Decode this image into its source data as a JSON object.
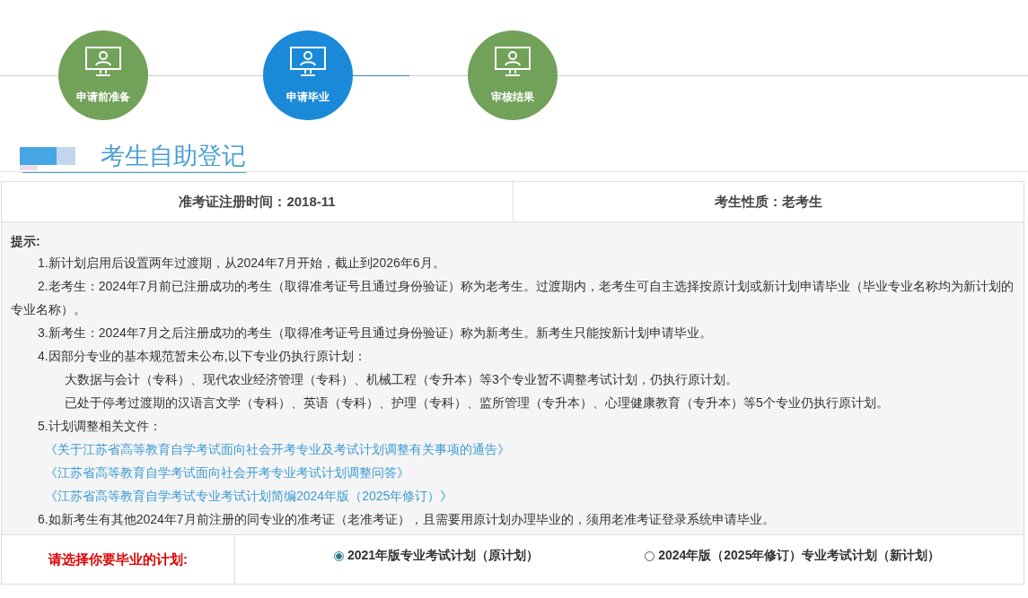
{
  "steps": [
    {
      "label": "申请前准备",
      "selected": false
    },
    {
      "label": "申请毕业",
      "selected": true
    },
    {
      "label": "审核结果",
      "selected": false
    }
  ],
  "section_title": "考生自助登记",
  "info": [
    {
      "label": "准考证注册时间：",
      "value": "2018-11"
    },
    {
      "label": "考生性质：",
      "value": "老考生"
    }
  ],
  "notes": {
    "heading": "提示:",
    "items": [
      {
        "text": "1.新计划启用后设置两年过渡期，从2024年7月开始，截止到2026年6月。"
      },
      {
        "text": "2.老考生：2024年7月前已注册成功的考生（取得准考证号且通过身份验证）称为老考生。过渡期内，老考生可自主选择按原计划或新计划申请毕业（毕业专业名称均为新计划的专业名称）。"
      },
      {
        "text": "3.新考生：2024年7月之后注册成功的考生（取得准考证号且通过身份验证）称为新考生。新考生只能按新计划申请毕业。"
      },
      {
        "text": "4.因部分专业的基本规范暂未公布,以下专业仍执行原计划：",
        "children": [
          {
            "kind": "text",
            "text": "大数据与会计（专科）、现代农业经济管理（专科）、机械工程（专升本）等3个专业暂不调整考试计划，仍执行原计划。"
          },
          {
            "kind": "text",
            "text": "已处于停考过渡期的汉语言文学（专科）、英语（专科）、护理（专科）、监所管理（专升本）、心理健康教育（专升本）等5个专业仍执行原计划。"
          }
        ]
      },
      {
        "text": "5.计划调整相关文件：",
        "children": [
          {
            "kind": "link",
            "text": "《关于江苏省高等教育自学考试面向社会开考专业及考试计划调整有关事项的通告》"
          },
          {
            "kind": "link",
            "text": "《江苏省高等教育自学考试面向社会开考专业考试计划调整问答》"
          },
          {
            "kind": "link",
            "text": "《江苏省高等教育自学考试专业考试计划简编2024年版（2025年修订）》"
          }
        ]
      },
      {
        "text": "6.如新考生有其他2024年7月前注册的同专业的准考证（老准考证），且需要用原计划办理毕业的，须用老准考证登录系统申请毕业。"
      }
    ]
  },
  "plan_choice": {
    "label": "请选择你要毕业的计划:",
    "options": [
      {
        "label": "2021年版专业考试计划（原计划）",
        "selected": true
      },
      {
        "label": "2024年版（2025年修订）专业考试计划（新计划）",
        "selected": false
      }
    ]
  }
}
